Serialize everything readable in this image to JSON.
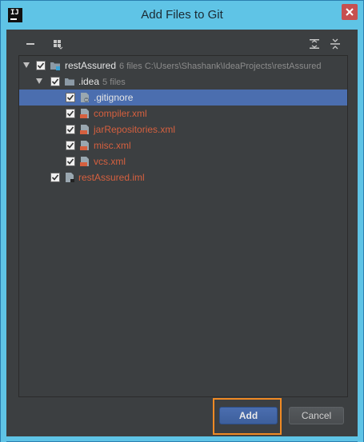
{
  "window": {
    "title": "Add Files to Git",
    "app_icon_text": "IJ"
  },
  "toolbar": {
    "collapse_icon": "minus-icon",
    "group_icon": "group-by-icon",
    "expand_all_icon": "expand-all-icon",
    "collapse_all_icon": "collapse-all-icon"
  },
  "tree": {
    "root": {
      "name": "restAssured",
      "meta": "6 files  C:\\Users\\Shashank\\IdeaProjects\\restAssured"
    },
    "idea_folder": {
      "name": ".idea",
      "meta": "5 files"
    },
    "files": [
      {
        "name": ".gitignore",
        "selected": true
      },
      {
        "name": "compiler.xml",
        "selected": false
      },
      {
        "name": "jarRepositories.xml",
        "selected": false
      },
      {
        "name": "misc.xml",
        "selected": false
      },
      {
        "name": "vcs.xml",
        "selected": false
      }
    ],
    "iml_file": {
      "name": "restAssured.iml"
    }
  },
  "buttons": {
    "add_label": "Add",
    "cancel_label": "Cancel"
  },
  "colors": {
    "title_bar": "#5fc4e6",
    "selection": "#4b6eaf",
    "unversioned_file": "#d6603f",
    "highlight": "#f08a24"
  }
}
